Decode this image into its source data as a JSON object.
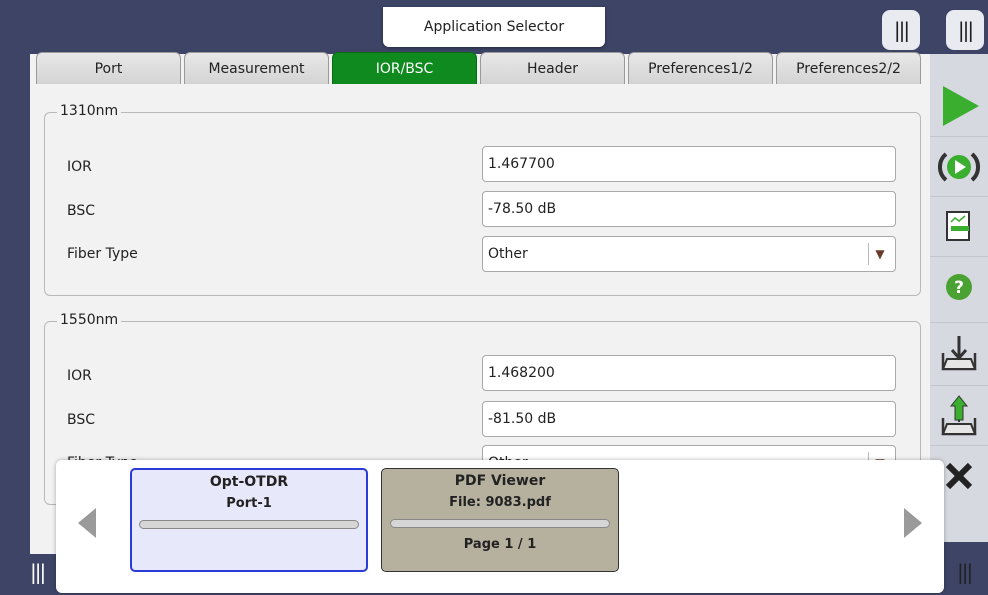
{
  "header": {
    "app_selector_label": "Application Selector"
  },
  "tabs": [
    {
      "label": "Port",
      "active": false
    },
    {
      "label": "Measurement",
      "active": false
    },
    {
      "label": "IOR/BSC",
      "active": true
    },
    {
      "label": "Header",
      "active": false
    },
    {
      "label": "Preferences1/2",
      "active": false
    },
    {
      "label": "Preferences2/2",
      "active": false
    }
  ],
  "groups": {
    "g1310": {
      "title": "1310nm",
      "ior_label": "IOR",
      "ior_value": "1.467700",
      "bsc_label": "BSC",
      "bsc_value": "-78.50 dB",
      "fiber_label": "Fiber Type",
      "fiber_value": "Other"
    },
    "g1550": {
      "title": "1550nm",
      "ior_label": "IOR",
      "ior_value": "1.468200",
      "bsc_label": "BSC",
      "bsc_value": "-81.50 dB",
      "fiber_label": "Fiber Type",
      "fiber_value": "Other"
    }
  },
  "sidebar": {
    "icons": [
      "play-icon",
      "repeat-icon",
      "report-icon",
      "help-icon",
      "load-icon",
      "save-icon",
      "close-icon"
    ],
    "colors": {
      "play": "#3aae2f",
      "help": "#4aa232"
    }
  },
  "task_panel": {
    "cards": [
      {
        "title": "Opt-OTDR",
        "subtitle": "Port-1",
        "selected": true
      },
      {
        "title": "PDF Viewer",
        "subtitle": "File: 9083.pdf",
        "footer": "Page 1 / 1",
        "selected": false
      }
    ]
  },
  "colors": {
    "active_tab": "#0e8a1e",
    "frame": "#3d4466"
  }
}
